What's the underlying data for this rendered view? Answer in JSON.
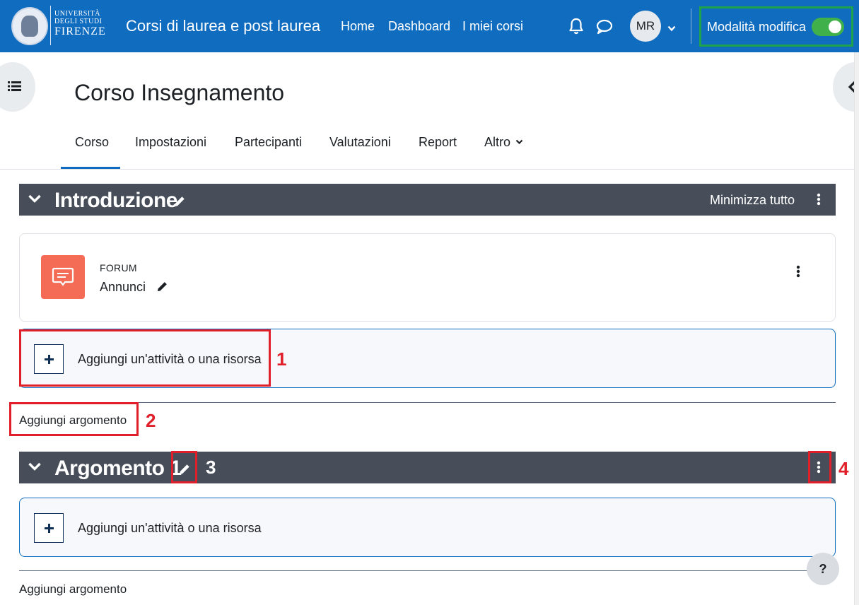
{
  "navbar": {
    "logo_line1": "UNIVERSITÀ",
    "logo_line2": "DEGLI STUDI",
    "logo_line3": "FIRENZE",
    "site_name": "Corsi di laurea e post laurea",
    "links": [
      "Home",
      "Dashboard",
      "I miei corsi"
    ],
    "avatar_initials": "MR",
    "edit_mode_label": "Modalità modifica",
    "edit_mode_on": true,
    "bg_color": "#0f6cbf"
  },
  "page": {
    "title": "Corso Insegnamento",
    "tabs": [
      "Corso",
      "Impostazioni",
      "Partecipanti",
      "Valutazioni",
      "Report",
      "Altro"
    ],
    "active_tab": "Corso"
  },
  "sections": [
    {
      "title": "Introduzione",
      "collapse_all_label": "Minimizza tutto",
      "activity": {
        "type": "FORUM",
        "name": "Annunci"
      },
      "add_activity_label": "Aggiungi un'attività o una risorsa",
      "add_topic_label": "Aggiungi argomento"
    },
    {
      "title": "Argomento 1",
      "add_activity_label": "Aggiungi un'attività o una risorsa",
      "add_topic_label": "Aggiungi argomento"
    }
  ],
  "callouts": [
    "1",
    "2",
    "3",
    "4"
  ],
  "help_label": "?",
  "colors": {
    "annotation_red": "#e01f2a",
    "annotation_green": "#1fa34a",
    "section_header": "#474e59",
    "forum_icon": "#f46b56"
  }
}
